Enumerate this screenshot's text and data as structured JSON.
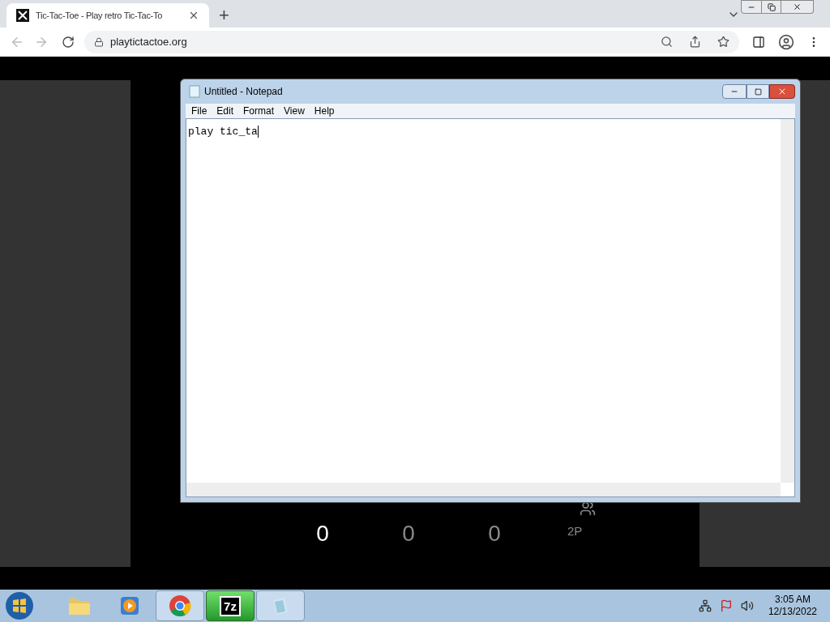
{
  "browser": {
    "tab": {
      "title": "Tic-Tac-Toe - Play retro Tic-Tac-To",
      "selected": true
    },
    "new_tab": "+",
    "address": "playtictactoe.org"
  },
  "game": {
    "scores": [
      {
        "value": "0",
        "active": true
      },
      {
        "value": "0",
        "active": false
      },
      {
        "value": "0",
        "active": false
      }
    ],
    "mode": "2P"
  },
  "notepad": {
    "title": "Untitled - Notepad",
    "menu": [
      "File",
      "Edit",
      "Format",
      "View",
      "Help"
    ],
    "text": "play tic_ta"
  },
  "taskbar": {
    "apps": [
      {
        "kind": "folder",
        "running": false
      },
      {
        "kind": "media",
        "running": false
      },
      {
        "kind": "chrome",
        "running": true,
        "selected": false
      },
      {
        "kind": "sevenzip",
        "label": "7z",
        "running": true,
        "selected": true
      },
      {
        "kind": "notepad",
        "running": true,
        "selected": false
      }
    ],
    "time": "3:05 AM",
    "date": "12/13/2022"
  }
}
